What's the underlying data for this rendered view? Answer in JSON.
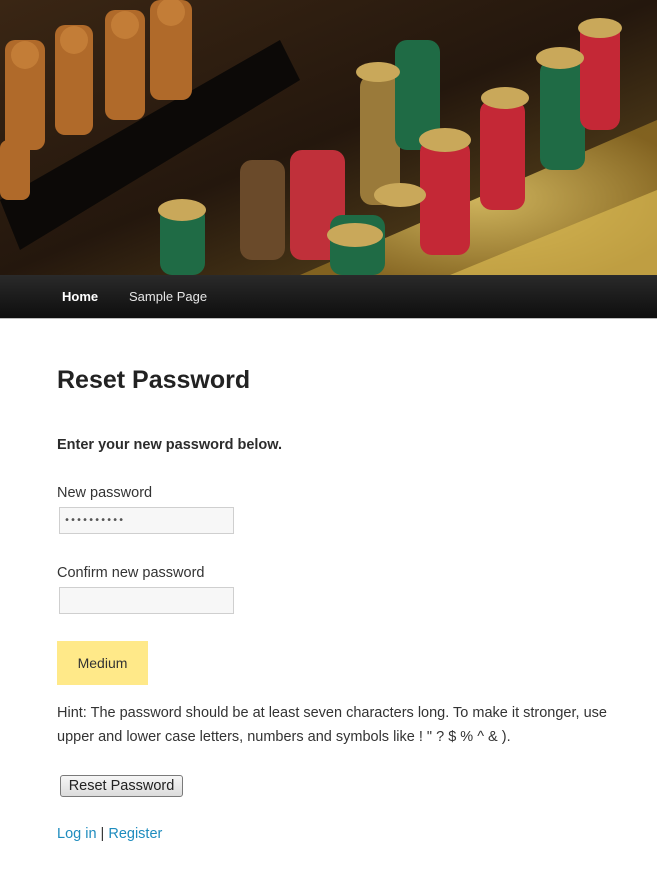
{
  "nav": {
    "items": [
      {
        "label": "Home",
        "active": true
      },
      {
        "label": "Sample Page",
        "active": false
      }
    ]
  },
  "page": {
    "title": "Reset Password",
    "intro": "Enter your new password below."
  },
  "form": {
    "new_password_label": "New password",
    "new_password_value": "••••••••••",
    "confirm_password_label": "Confirm new password",
    "confirm_password_value": "",
    "strength_label": "Medium",
    "strength_color": "#ffe989",
    "hint": "Hint: The password should be at least seven characters long. To make it stronger, use upper and lower case letters, numbers and symbols like ! \" ? $ % ^ & ).",
    "submit_label": "Reset Password"
  },
  "footer_links": {
    "login": "Log in",
    "separator": " | ",
    "register": "Register"
  },
  "colors": {
    "link": "#1e8cbe",
    "navbar": "#1a1a1a"
  }
}
